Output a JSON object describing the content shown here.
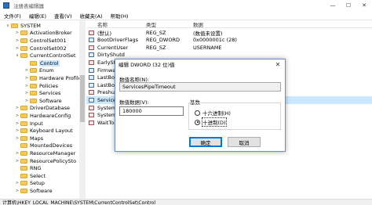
{
  "window": {
    "title": "注册表编辑器",
    "controls": [
      "—",
      "☐",
      "✕"
    ]
  },
  "menu": [
    "文件(F)",
    "编辑(E)",
    "查看(V)",
    "收藏夹(A)",
    "帮助(H)"
  ],
  "tree": [
    {
      "label": "SYSTEM",
      "indent": 0,
      "exp": "∨"
    },
    {
      "label": "ActivationBroker",
      "indent": 1,
      "exp": ">"
    },
    {
      "label": "ControlSet001",
      "indent": 1,
      "exp": ">"
    },
    {
      "label": "ControlSet002",
      "indent": 1,
      "exp": ">"
    },
    {
      "label": "CurrentControlSet",
      "indent": 1,
      "exp": "∨"
    },
    {
      "label": "Control",
      "indent": 2,
      "exp": "",
      "selected": true
    },
    {
      "label": "Enum",
      "indent": 2,
      "exp": ">"
    },
    {
      "label": "Hardware Profiles",
      "indent": 2,
      "exp": ">"
    },
    {
      "label": "Policies",
      "indent": 2,
      "exp": ">"
    },
    {
      "label": "Services",
      "indent": 2,
      "exp": ">"
    },
    {
      "label": "Software",
      "indent": 2,
      "exp": ">"
    },
    {
      "label": "DriverDatabase",
      "indent": 1,
      "exp": ">"
    },
    {
      "label": "HardwareConfig",
      "indent": 1,
      "exp": ">"
    },
    {
      "label": "Input",
      "indent": 1,
      "exp": ">"
    },
    {
      "label": "Keyboard Layout",
      "indent": 1,
      "exp": ">"
    },
    {
      "label": "Maps",
      "indent": 1,
      "exp": ">"
    },
    {
      "label": "MountedDevices",
      "indent": 1,
      "exp": ""
    },
    {
      "label": "ResourceManager",
      "indent": 1,
      "exp": ">"
    },
    {
      "label": "ResourcePolicySto",
      "indent": 1,
      "exp": ">"
    },
    {
      "label": "RNG",
      "indent": 1,
      "exp": ""
    },
    {
      "label": "Select",
      "indent": 1,
      "exp": ""
    },
    {
      "label": "Setup",
      "indent": 1,
      "exp": ">"
    },
    {
      "label": "Software",
      "indent": 1,
      "exp": ">"
    }
  ],
  "list": {
    "headers": {
      "name": "名称",
      "type": "类型",
      "data": "数据"
    },
    "rows": [
      {
        "name": "(默认)",
        "type": "REG_SZ",
        "data": "(数值未设置)",
        "icon": "ab"
      },
      {
        "name": "BootDriverFlags",
        "type": "REG_DWORD",
        "data": "0x0000001c (28)",
        "icon": "num"
      },
      {
        "name": "CurrentUser",
        "type": "REG_SZ",
        "data": "USERNAME",
        "icon": "ab"
      },
      {
        "name": "DirtyShutd",
        "type": "",
        "data": "",
        "icon": "num"
      },
      {
        "name": "EarlyStart",
        "type": "",
        "data": "ure SystemEve...",
        "icon": "ab"
      },
      {
        "name": "Firmware",
        "type": "",
        "data": "",
        "icon": "num"
      },
      {
        "name": "LastBootS",
        "type": "",
        "data": "",
        "icon": "num"
      },
      {
        "name": "LastBootS",
        "type": "",
        "data": "",
        "icon": "num"
      },
      {
        "name": "Preshutd",
        "type": "",
        "data": "taller",
        "icon": "ab"
      },
      {
        "name": "ServicesPi",
        "type": "",
        "data": "",
        "icon": "num",
        "selected": true
      },
      {
        "name": "SystemBo",
        "type": "",
        "data": "",
        "icon": "ab"
      },
      {
        "name": "SystemSta",
        "type": "",
        "data": "=OPTOUT",
        "icon": "ab"
      },
      {
        "name": "WaitToKil",
        "type": "",
        "data": "",
        "icon": "ab"
      }
    ]
  },
  "dialog": {
    "title": "编辑 DWORD (32 位)值",
    "close": "✕",
    "name_label": "数值名称(N):",
    "name_value": "ServicesPipeTimeout",
    "data_label": "数值数据(V):",
    "data_value": "180000",
    "base_label": "基数",
    "hex_label": "十六进制(H)",
    "dec_label": "十进制(D)",
    "ok": "确定",
    "cancel": "取消"
  },
  "status": "计算机\\HKEY_LOCAL_MACHINE\\SYSTEM\\CurrentControlSet\\Control"
}
